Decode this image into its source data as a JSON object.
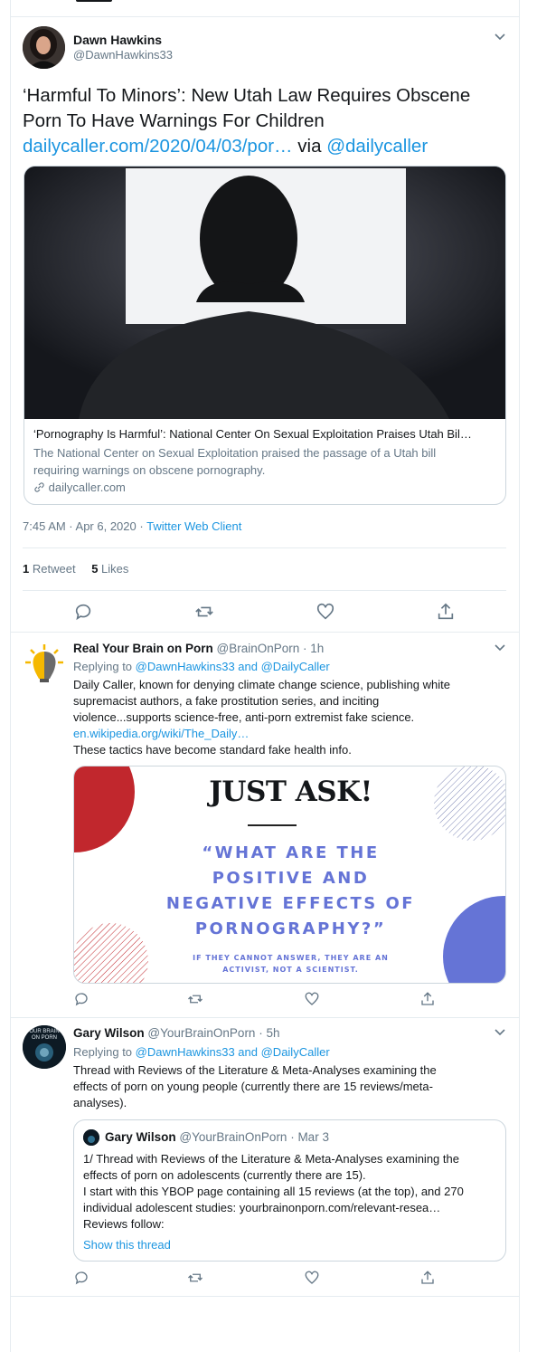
{
  "main_tweet": {
    "display_name": "Dawn Hawkins",
    "handle": "@DawnHawkins33",
    "text_part1": "‘Harmful To Minors’: New Utah Law Requires Obscene",
    "text_part2": "Porn To Have Warnings For Children",
    "link": "dailycaller.com/2020/04/03/por…",
    "via": "via",
    "via_handle": "@dailycaller",
    "card": {
      "title": "‘Pornography Is Harmful’: National Center On Sexual Exploitation Praises Utah Bil…",
      "description_line1": "The National Center on Sexual Exploitation praised the passage of a Utah bill",
      "description_line2": "requiring warnings on obscene pornography.",
      "domain": "dailycaller.com"
    },
    "time": "7:45 AM · Apr 6, 2020",
    "dot": "·",
    "client": "Twitter Web Client",
    "retweets_count": "1",
    "retweets_label": "Retweet",
    "likes_count": "5",
    "likes_label": "Likes"
  },
  "reply1": {
    "display_name": "Real Your Brain on Porn",
    "handle_time": "@BrainOnPorn · 1h",
    "replying_label": "Replying to",
    "replying_to": "@DawnHawkins33 and @DailyCaller",
    "line1": "Daily Caller, known for denying climate change science, publishing white",
    "line2": "supremacist authors, a fake prostitution series, and inciting",
    "line3": "violence...supports science-free, anti-porn extremist fake science.",
    "link": "en.wikipedia.org/wiki/The_Daily…",
    "line4": "These tactics have become standard fake health info.",
    "image": {
      "headline": "JUST ASK!",
      "question_l1": "“WHAT ARE THE",
      "question_l2": "POSITIVE AND",
      "question_l3": "NEGATIVE EFFECTS OF",
      "question_l4": "PORNOGRAPHY?”",
      "footnote_l1": "IF THEY CANNOT ANSWER, THEY ARE AN",
      "footnote_l2": "ACTIVIST, NOT A SCIENTIST."
    }
  },
  "reply2": {
    "display_name": "Gary Wilson",
    "handle_time": "@YourBrainOnPorn · 5h",
    "replying_label": "Replying to",
    "replying_to": "@DawnHawkins33 and @DailyCaller",
    "line1": "Thread with Reviews of the Literature & Meta-Analyses  examining the",
    "line2": "effects of porn on young people (currently there are 15 reviews/meta-",
    "line3": "analyses).",
    "avatar_text_l1": "OUR BRAIN",
    "avatar_text_l2": "ON PORN",
    "quote": {
      "display_name": "Gary Wilson",
      "handle_time": "@YourBrainOnPorn · Mar 3",
      "line1": "1/ Thread with Reviews of the Literature & Meta-Analyses  examining the",
      "line2": "effects of porn on adolescents (currently there are 15).",
      "line3": "I start with this YBOP page containing all 15 reviews (at the top), and 270",
      "line4": "individual adolescent studies: yourbrainonporn.com/relevant-resea…",
      "line5": "Reviews follow:",
      "show_thread": "Show this thread"
    }
  },
  "colors": {
    "link": "#1b95e0",
    "muted": "#657786",
    "border": "#e6ecf0",
    "poster_red": "#c1272d",
    "poster_blue": "#6574d6"
  }
}
